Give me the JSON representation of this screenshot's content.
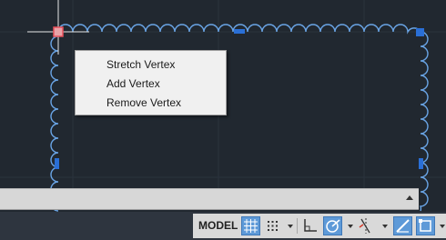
{
  "context_menu": {
    "items": [
      {
        "label": "Stretch Vertex"
      },
      {
        "label": "Add Vertex"
      },
      {
        "label": "Remove Vertex"
      }
    ]
  },
  "status_bar": {
    "model_label": "MODEL",
    "grid_icon": "grid-display-icon",
    "snap_icon": "snap-mode-icon",
    "ortho_icon": "ortho-mode-icon",
    "polar_icon": "polar-tracking-icon",
    "osnap_icon": "object-snap-tracking-icon",
    "lineweight_icon": "lineweight-icon",
    "selection_icon": "selection-cycling-icon"
  },
  "colors": {
    "background": "#212830",
    "cloud_stroke": "#6aa5e6",
    "grip": "#2a6fd6",
    "hot_grip": "#e8505a",
    "active_toggle": "#5e9ad8"
  }
}
